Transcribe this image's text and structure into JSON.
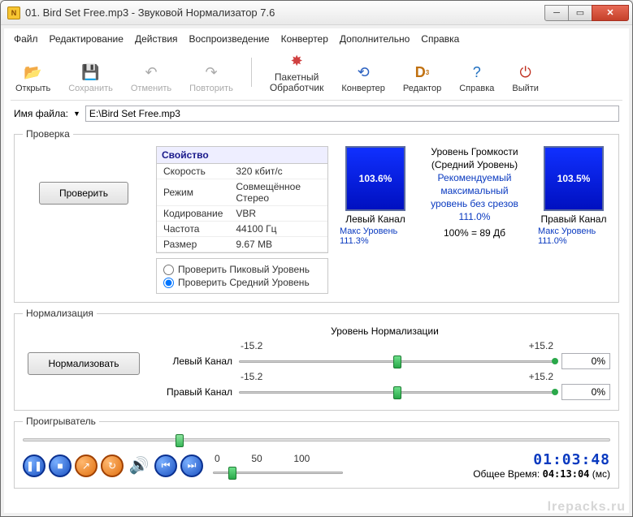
{
  "window": {
    "title": "01. Bird Set Free.mp3 - Звуковой Нормализатор 7.6"
  },
  "menu": [
    "Файл",
    "Редактирование",
    "Действия",
    "Воспроизведение",
    "Конвертер",
    "Дополнительно",
    "Справка"
  ],
  "toolbar": {
    "open": "Открыть",
    "save": "Сохранить",
    "undo": "Отменить",
    "redo": "Повторить",
    "batch_line1": "Пакетный",
    "batch_line2": "Обработчик",
    "converter": "Конвертер",
    "editor": "Редактор",
    "help": "Справка",
    "exit": "Выйти"
  },
  "file": {
    "label": "Имя файла:",
    "path": "E:\\Bird Set Free.mp3"
  },
  "check": {
    "legend": "Проверка",
    "button": "Проверить",
    "prop_header": "Свойство",
    "rows": {
      "speed_k": "Скорость",
      "speed_v": "320 кбит/с",
      "mode_k": "Режим",
      "mode_v": "Совмещённое Стерео",
      "enc_k": "Кодирование",
      "enc_v": "VBR",
      "freq_k": "Частота",
      "freq_v": "44100 Гц",
      "size_k": "Размер",
      "size_v": "9.67 МВ"
    },
    "radio_peak": "Проверить Пиковый Уровень",
    "radio_avg": "Проверить Средний Уровень",
    "left_ch": "Левый Канал",
    "right_ch": "Правый Канал",
    "left_val": "103.6%",
    "right_val": "103.5%",
    "vol_title": "Уровень Громкости",
    "vol_sub": "(Средний Уровень)",
    "reco1": "Рекомендуемый",
    "reco2": "максимальный",
    "reco3": "уровень без срезов",
    "reco4": "111.0%",
    "scale": "100% = 89 Дб",
    "max_left": "Макс Уровень 111.3%",
    "max_right": "Макс Уровень 111.0%"
  },
  "norm": {
    "legend": "Нормализация",
    "button": "Нормализовать",
    "header": "Уровень Нормализации",
    "min": "-15.2",
    "max": "+15.2",
    "left_lbl": "Левый Канал",
    "right_lbl": "Правый Канал",
    "left_val": "0%",
    "right_val": "0%"
  },
  "player": {
    "legend": "Проигрыватель",
    "ticks": {
      "t0": "0",
      "t50": "50",
      "t100": "100"
    },
    "elapsed": "01:03:48",
    "total_lbl": "Общее Время:",
    "total": "04:13:04",
    "unit": "(мс)"
  },
  "watermark": "lrepacks.ru"
}
